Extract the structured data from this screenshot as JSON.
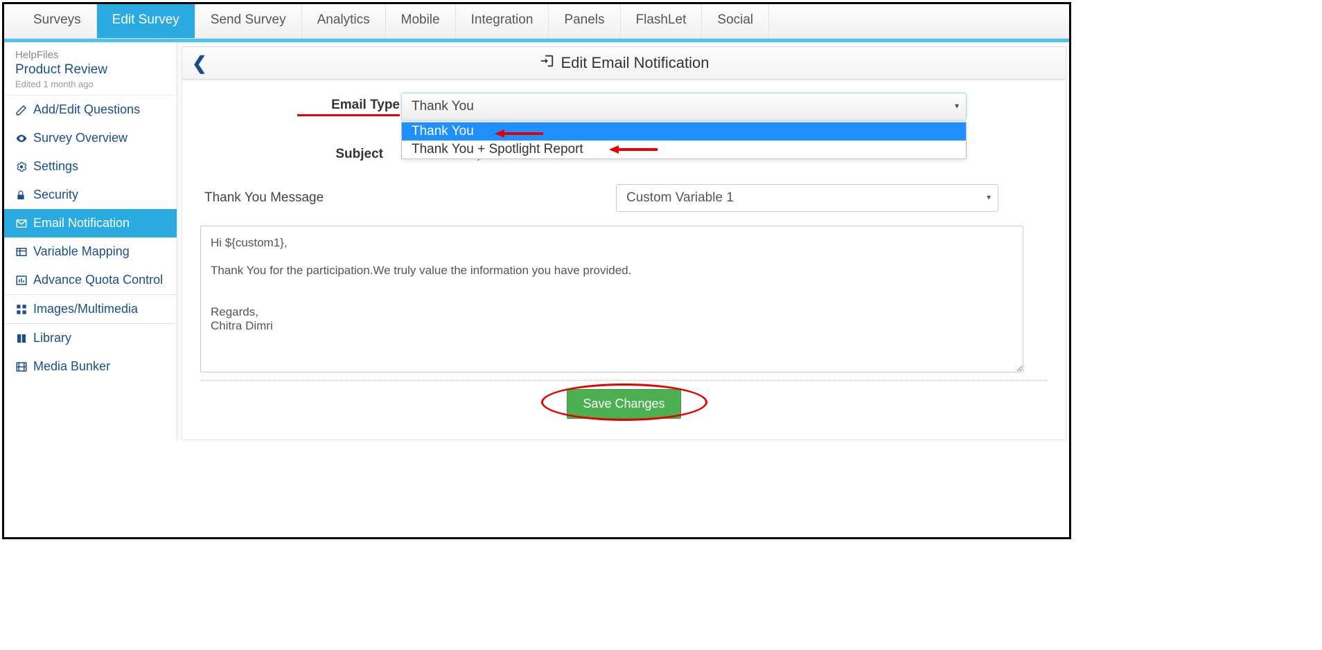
{
  "topnav": {
    "tabs": [
      "Surveys",
      "Edit Survey",
      "Send Survey",
      "Analytics",
      "Mobile",
      "Integration",
      "Panels",
      "FlashLet",
      "Social"
    ],
    "active_index": 1
  },
  "sidebar": {
    "helpfiles_label": "HelpFiles",
    "title": "Product Review",
    "edited": "Edited 1 month ago",
    "items": [
      {
        "icon": "edit",
        "label": "Add/Edit Questions"
      },
      {
        "icon": "eye",
        "label": "Survey Overview"
      },
      {
        "icon": "gears",
        "label": "Settings"
      },
      {
        "icon": "lock",
        "label": "Security"
      },
      {
        "icon": "mail",
        "label": "Email Notification"
      },
      {
        "icon": "table",
        "label": "Variable Mapping"
      },
      {
        "icon": "chart",
        "label": "Advance Quota Control"
      },
      {
        "icon": "grid",
        "label": "Images/Multimedia"
      },
      {
        "icon": "book",
        "label": "Library"
      },
      {
        "icon": "film",
        "label": "Media Bunker"
      }
    ],
    "active_index": 4
  },
  "main": {
    "header": "Edit Email Notification",
    "email_type_label": "Email Type",
    "email_type_value": "Thank You",
    "email_type_options": [
      "Thank You",
      "Thank You + Spotlight Report"
    ],
    "subject_label": "Subject",
    "subject_value": "Thanks for your time",
    "message_label": "Thank You Message",
    "variable_select": "Custom Variable 1",
    "message_body": "Hi ${custom1},\n\nThank You for the participation.We truly value the information you have provided.\n\n\nRegards,\nChitra Dimri",
    "save_label": "Save Changes"
  }
}
